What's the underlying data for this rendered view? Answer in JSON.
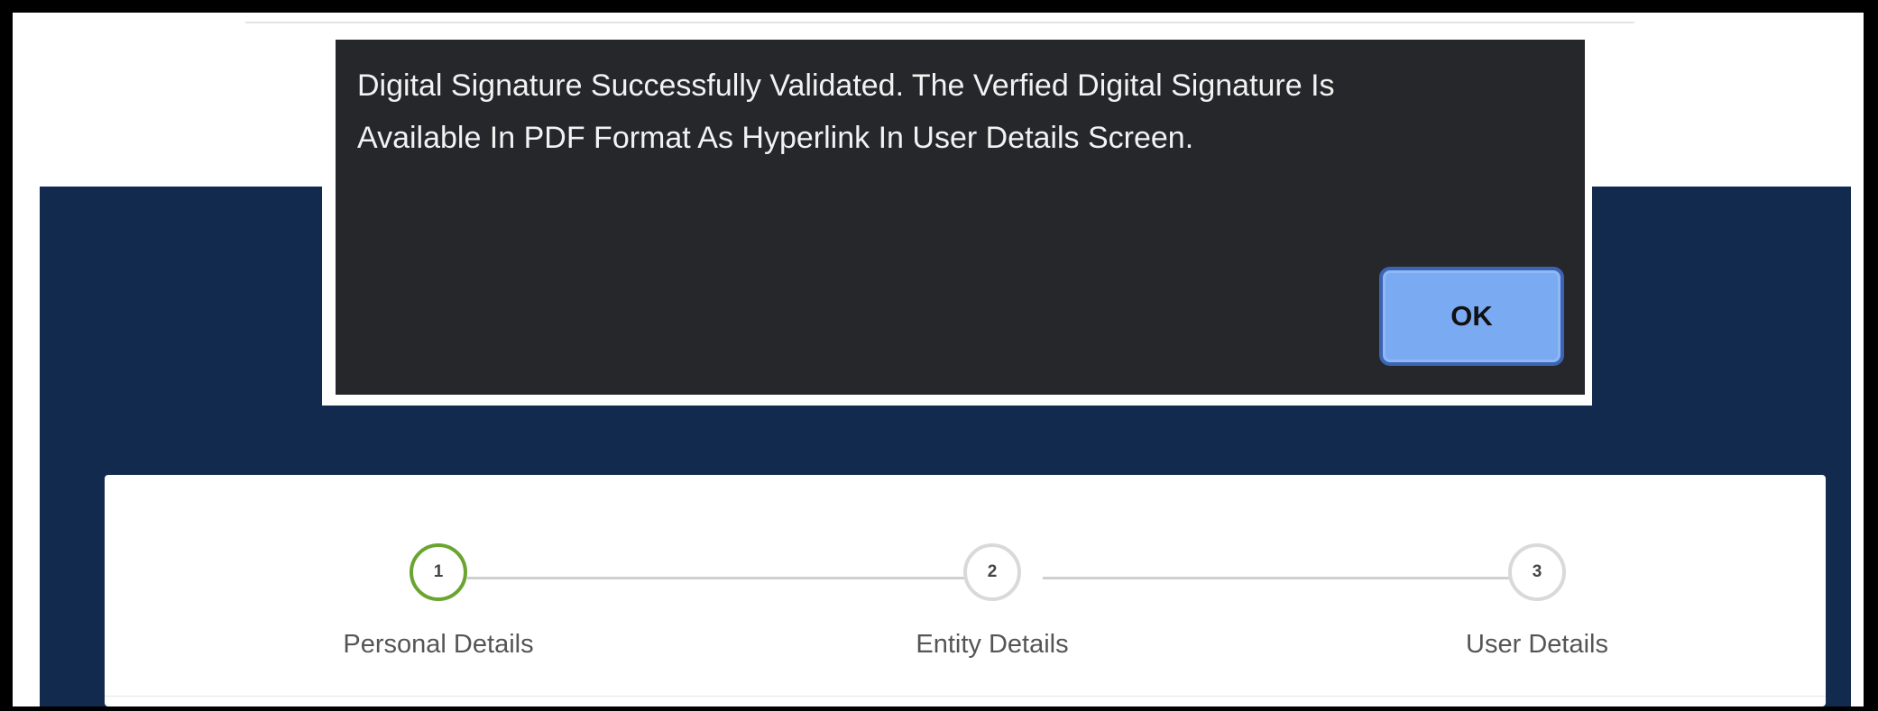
{
  "dialog": {
    "message_line1": "Digital Signature Successfully Validated. The Verfied Digital Signature Is",
    "message_line2": "Available In PDF Format As Hyperlink In User Details Screen.",
    "ok_label": "OK"
  },
  "stepper": {
    "steps": [
      {
        "number": "1",
        "label": "Personal Details",
        "state": "active"
      },
      {
        "number": "2",
        "label": "Entity Details",
        "state": "pending"
      },
      {
        "number": "3",
        "label": "User Details",
        "state": "pending"
      }
    ]
  },
  "colors": {
    "band": "#122a4d",
    "dialog_bg": "#26272b",
    "active_step": "#6aa431",
    "ok_button": "#7aaaf2"
  }
}
